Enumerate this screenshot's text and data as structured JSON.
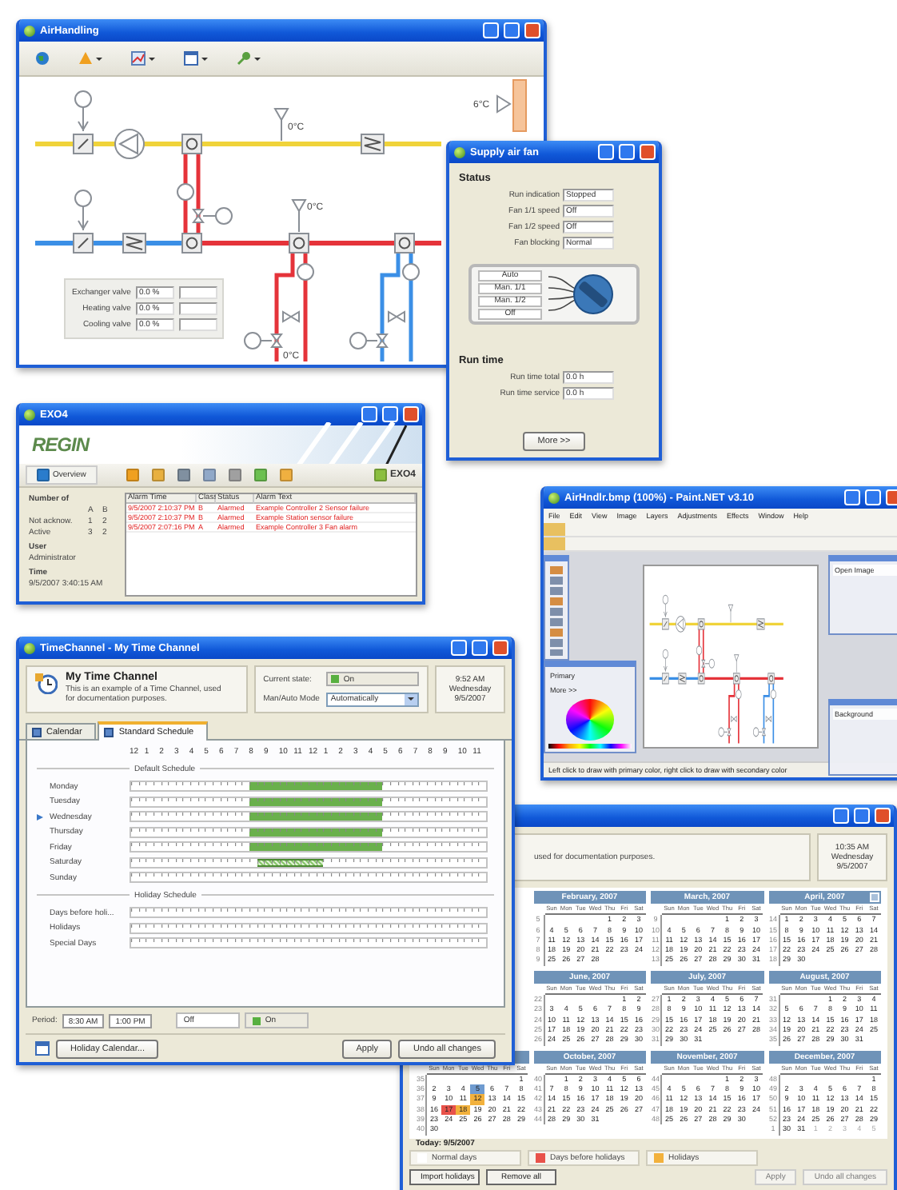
{
  "airhandling": {
    "title": "AirHandling",
    "temps": {
      "supply": "0°C",
      "heating": "0°C",
      "water": "0°C",
      "outdoor": "6°C"
    },
    "valves": [
      {
        "label": "Exchanger valve",
        "value": "0.0 %"
      },
      {
        "label": "Heating valve",
        "value": "0.0 %"
      },
      {
        "label": "Cooling valve",
        "value": "0.0 %"
      }
    ]
  },
  "fan": {
    "title": "Supply air fan",
    "status_heading": "Status",
    "status": [
      {
        "label": "Run indication",
        "value": "Stopped"
      },
      {
        "label": "Fan 1/1 speed",
        "value": "Off"
      },
      {
        "label": "Fan 1/2 speed",
        "value": "Off"
      },
      {
        "label": "Fan blocking",
        "value": "Normal"
      }
    ],
    "switch": [
      "Auto",
      "Man. 1/1",
      "Man. 1/2",
      "Off"
    ],
    "runtime_heading": "Run time",
    "runtime": [
      {
        "label": "Run time total",
        "value": "0.0 h"
      },
      {
        "label": "Run time service",
        "value": "0.0 h"
      }
    ],
    "button": "More >>"
  },
  "exo": {
    "title": "EXO4",
    "logo": "REGIN",
    "overview": "Overview",
    "brand": "EXO4",
    "summary": {
      "heading": "Number of",
      "columns": [
        "A",
        "B"
      ],
      "rows": [
        {
          "label": "Not acknow.",
          "values": [
            "1",
            "2"
          ]
        },
        {
          "label": "Active",
          "values": [
            "3",
            "2"
          ]
        }
      ]
    },
    "user_heading": "User",
    "user": "Administrator",
    "time_heading": "Time",
    "time": "9/5/2007 3:40:15 AM",
    "alarms": {
      "columns": [
        "Alarm Time",
        "Class",
        "Status",
        "Alarm Text"
      ],
      "rows": [
        [
          "9/5/2007 2:10:37 PM",
          "B",
          "Alarmed",
          "Example Controller 2 Sensor failure"
        ],
        [
          "9/5/2007 2:10:37 PM",
          "B",
          "Alarmed",
          "Example Station sensor failure"
        ],
        [
          "9/5/2007 2:07:16 PM",
          "A",
          "Alarmed",
          "Example Controller 3 Fan alarm"
        ]
      ]
    }
  },
  "paint": {
    "title": "AirHndlr.bmp (100%) - Paint.NET v3.10",
    "menu": [
      "File",
      "Edit",
      "View",
      "Image",
      "Layers",
      "Adjustments",
      "Effects",
      "Window",
      "Help"
    ],
    "history": [
      "Open Image"
    ],
    "layers": [
      "Background"
    ],
    "color_mode": "Primary",
    "more": "More >>",
    "status": "Left click to draw with primary color, right click to draw with secondary color"
  },
  "timechannel": {
    "title": "TimeChannel - My Time Channel",
    "name": "My Time Channel",
    "description": "This is an example of a Time Channel, used for documentation purposes.",
    "current_state_label": "Current state:",
    "current_state": "On",
    "mode_label": "Man/Auto Mode",
    "mode": "Automatically",
    "clock": [
      "9:52 AM",
      "Wednesday",
      "9/5/2007"
    ],
    "tabs": [
      {
        "label": "Calendar",
        "selected": false
      },
      {
        "label": "Standard Schedule",
        "selected": true
      }
    ],
    "hours": [
      "12",
      "1",
      "2",
      "3",
      "4",
      "5",
      "6",
      "7",
      "8",
      "9",
      "10",
      "11",
      "12",
      "1",
      "2",
      "3",
      "4",
      "5",
      "6",
      "7",
      "8",
      "9",
      "10",
      "11"
    ],
    "default_heading": "Default Schedule",
    "days": [
      {
        "label": "Monday",
        "current": false,
        "selected": false,
        "slots": [
          false,
          false,
          false,
          false,
          false,
          false,
          false,
          false,
          false,
          false,
          false,
          false,
          false,
          false,
          false,
          false,
          true,
          true,
          true,
          true,
          true,
          true,
          true,
          true,
          true,
          true,
          true,
          true,
          true,
          true,
          true,
          true,
          true,
          true,
          false,
          false,
          false,
          false,
          false,
          false,
          false,
          false,
          false,
          false,
          false,
          false,
          false,
          false
        ]
      },
      {
        "label": "Tuesday",
        "current": false,
        "selected": false,
        "slots": [
          false,
          false,
          false,
          false,
          false,
          false,
          false,
          false,
          false,
          false,
          false,
          false,
          false,
          false,
          false,
          false,
          true,
          true,
          true,
          true,
          true,
          true,
          true,
          true,
          true,
          true,
          true,
          true,
          true,
          true,
          true,
          true,
          true,
          true,
          false,
          false,
          false,
          false,
          false,
          false,
          false,
          false,
          false,
          false,
          false,
          false,
          false,
          false
        ]
      },
      {
        "label": "Wednesday",
        "current": true,
        "selected": false,
        "slots": [
          false,
          false,
          false,
          false,
          false,
          false,
          false,
          false,
          false,
          false,
          false,
          false,
          false,
          false,
          false,
          false,
          true,
          true,
          true,
          true,
          true,
          true,
          true,
          true,
          true,
          true,
          true,
          true,
          true,
          true,
          true,
          true,
          true,
          true,
          false,
          false,
          false,
          false,
          false,
          false,
          false,
          false,
          false,
          false,
          false,
          false,
          false,
          false
        ]
      },
      {
        "label": "Thursday",
        "current": false,
        "selected": false,
        "slots": [
          false,
          false,
          false,
          false,
          false,
          false,
          false,
          false,
          false,
          false,
          false,
          false,
          false,
          false,
          false,
          false,
          true,
          true,
          true,
          true,
          true,
          true,
          true,
          true,
          true,
          true,
          true,
          true,
          true,
          true,
          true,
          true,
          true,
          true,
          false,
          false,
          false,
          false,
          false,
          false,
          false,
          false,
          false,
          false,
          false,
          false,
          false,
          false
        ]
      },
      {
        "label": "Friday",
        "current": false,
        "selected": false,
        "slots": [
          false,
          false,
          false,
          false,
          false,
          false,
          false,
          false,
          false,
          false,
          false,
          false,
          false,
          false,
          false,
          false,
          true,
          true,
          true,
          true,
          true,
          true,
          true,
          true,
          true,
          true,
          true,
          true,
          true,
          true,
          true,
          true,
          true,
          true,
          false,
          false,
          false,
          false,
          false,
          false,
          false,
          false,
          false,
          false,
          false,
          false,
          false,
          false
        ]
      },
      {
        "label": "Saturday",
        "current": false,
        "selected": true,
        "slots": [
          false,
          false,
          false,
          false,
          false,
          false,
          false,
          false,
          false,
          false,
          false,
          false,
          false,
          false,
          false,
          false,
          false,
          true,
          true,
          true,
          true,
          true,
          true,
          true,
          true,
          true,
          false,
          false,
          false,
          false,
          false,
          false,
          false,
          false,
          false,
          false,
          false,
          false,
          false,
          false,
          false,
          false,
          false,
          false,
          false,
          false,
          false,
          false
        ]
      },
      {
        "label": "Sunday",
        "current": false,
        "slots": [
          false,
          false,
          false,
          false,
          false,
          false,
          false,
          false,
          false,
          false,
          false,
          false,
          false,
          false,
          false,
          false,
          false,
          false,
          false,
          false,
          false,
          false,
          false,
          false,
          false,
          false,
          false,
          false,
          false,
          false,
          false,
          false,
          false,
          false,
          false,
          false,
          false,
          false,
          false,
          false,
          false,
          false,
          false,
          false,
          false,
          false,
          false,
          false
        ]
      }
    ],
    "holiday_heading": "Holiday Schedule",
    "holiday_days": [
      {
        "label": "Days before holi...",
        "current": false,
        "slots": [
          false,
          false,
          false,
          false,
          false,
          false,
          false,
          false,
          false,
          false,
          false,
          false,
          false,
          false,
          false,
          false,
          false,
          false,
          false,
          false,
          false,
          false,
          false,
          false,
          false,
          false,
          false,
          false,
          false,
          false,
          false,
          false,
          false,
          false,
          false,
          false,
          false,
          false,
          false,
          false,
          false,
          false,
          false,
          false,
          false,
          false,
          false,
          false
        ]
      },
      {
        "label": "Holidays",
        "current": false,
        "slots": [
          false,
          false,
          false,
          false,
          false,
          false,
          false,
          false,
          false,
          false,
          false,
          false,
          false,
          false,
          false,
          false,
          false,
          false,
          false,
          false,
          false,
          false,
          false,
          false,
          false,
          false,
          false,
          false,
          false,
          false,
          false,
          false,
          false,
          false,
          false,
          false,
          false,
          false,
          false,
          false,
          false,
          false,
          false,
          false,
          false,
          false,
          false,
          false
        ]
      },
      {
        "label": "Special Days",
        "current": false,
        "slots": [
          false,
          false,
          false,
          false,
          false,
          false,
          false,
          false,
          false,
          false,
          false,
          false,
          false,
          false,
          false,
          false,
          false,
          false,
          false,
          false,
          false,
          false,
          false,
          false,
          false,
          false,
          false,
          false,
          false,
          false,
          false,
          false,
          false,
          false,
          false,
          false,
          false,
          false,
          false,
          false,
          false,
          false,
          false,
          false,
          false,
          false,
          false,
          false
        ]
      }
    ],
    "period_label": "Period:",
    "period_from": "8:30 AM",
    "period_to": "1:00 PM",
    "states": [
      {
        "label": "Off",
        "selected": false
      },
      {
        "label": "On",
        "selected": true
      }
    ],
    "buttons": {
      "holiday": "Holiday Calendar...",
      "apply": "Apply",
      "undo": "Undo all changes"
    }
  },
  "calendar": {
    "description": "used for documentation purposes.",
    "clock": [
      "10:35 AM",
      "Wednesday",
      "9/5/2007"
    ],
    "months": [
      {
        "name": "February, 2007",
        "weekdays": [
          "Sun",
          "Mon",
          "Tue",
          "Wed",
          "Thu",
          "Fri",
          "Sat"
        ],
        "weeks": [
          {
            "no": "5",
            "days": [
              "1",
              "2",
              "3"
            ]
          },
          {
            "no": "6",
            "days": [
              "4",
              "5",
              "6",
              "7",
              "8",
              "9",
              "10"
            ]
          },
          {
            "no": "7",
            "days": [
              "11",
              "12",
              "13",
              "14",
              "15",
              "16",
              "17"
            ]
          },
          {
            "no": "8",
            "days": [
              "18",
              "19",
              "20",
              "21",
              "22",
              "23",
              "24"
            ]
          },
          {
            "no": "9",
            "days": [
              "25",
              "26",
              "27",
              "28"
            ]
          }
        ]
      },
      {
        "name": "March, 2007",
        "weekdays": [
          "Sun",
          "Mon",
          "Tue",
          "Wed",
          "Thu",
          "Fri",
          "Sat"
        ],
        "weeks": [
          {
            "no": "9",
            "days": [
              "1",
              "2",
              "3"
            ]
          },
          {
            "no": "10",
            "days": [
              "4",
              "5",
              "6",
              "7",
              "8",
              "9",
              "10"
            ]
          },
          {
            "no": "11",
            "days": [
              "11",
              "12",
              "13",
              "14",
              "15",
              "16",
              "17"
            ]
          },
          {
            "no": "12",
            "days": [
              "18",
              "19",
              "20",
              "21",
              "22",
              "23",
              "24"
            ]
          },
          {
            "no": "13",
            "days": [
              "25",
              "26",
              "27",
              "28",
              "29",
              "30",
              "31"
            ]
          }
        ]
      },
      {
        "name": "April, 2007",
        "next_button": true,
        "weekdays": [
          "Sun",
          "Mon",
          "Tue",
          "Wed",
          "Thu",
          "Fri",
          "Sat"
        ],
        "weeks": [
          {
            "no": "14",
            "days": [
              "1",
              "2",
              "3",
              "4",
              "5",
              "6",
              "7"
            ]
          },
          {
            "no": "15",
            "days": [
              "8",
              "9",
              "10",
              "11",
              "12",
              "13",
              "14"
            ]
          },
          {
            "no": "16",
            "days": [
              "15",
              "16",
              "17",
              "18",
              "19",
              "20",
              "21"
            ]
          },
          {
            "no": "17",
            "days": [
              "22",
              "23",
              "24",
              "25",
              "26",
              "27",
              "28"
            ]
          },
          {
            "no": "18",
            "days": [
              "29",
              "30"
            ]
          }
        ]
      },
      {
        "name": "June, 2007",
        "weekdays": [
          "Sun",
          "Mon",
          "Tue",
          "Wed",
          "Thu",
          "Fri",
          "Sat"
        ],
        "weeks": [
          {
            "no": "22",
            "days": [
              "1",
              "2"
            ]
          },
          {
            "no": "23",
            "days": [
              "3",
              "4",
              "5",
              "6",
              "7",
              "8",
              "9"
            ]
          },
          {
            "no": "24",
            "days": [
              "10",
              "11",
              "12",
              "13",
              "14",
              "15",
              "16"
            ]
          },
          {
            "no": "25",
            "days": [
              "17",
              "18",
              "19",
              "20",
              "21",
              "22",
              "23"
            ]
          },
          {
            "no": "26",
            "days": [
              "24",
              "25",
              "26",
              "27",
              "28",
              "29",
              "30"
            ]
          }
        ]
      },
      {
        "name": "July, 2007",
        "weekdays": [
          "Sun",
          "Mon",
          "Tue",
          "Wed",
          "Thu",
          "Fri",
          "Sat"
        ],
        "weeks": [
          {
            "no": "27",
            "days": [
              "1",
              "2",
              "3",
              "4",
              "5",
              "6",
              "7"
            ]
          },
          {
            "no": "28",
            "days": [
              "8",
              "9",
              "10",
              "11",
              "12",
              "13",
              "14"
            ]
          },
          {
            "no": "29",
            "days": [
              "15",
              "16",
              "17",
              "18",
              "19",
              "20",
              "21"
            ]
          },
          {
            "no": "30",
            "days": [
              "22",
              "23",
              "24",
              "25",
              "26",
              "27",
              "28"
            ]
          },
          {
            "no": "31",
            "days": [
              "29",
              "30",
              "31"
            ]
          }
        ]
      },
      {
        "name": "August, 2007",
        "weekdays": [
          "Sun",
          "Mon",
          "Tue",
          "Wed",
          "Thu",
          "Fri",
          "Sat"
        ],
        "weeks": [
          {
            "no": "31",
            "days": [
              "1",
              "2",
              "3",
              "4"
            ]
          },
          {
            "no": "32",
            "days": [
              "5",
              "6",
              "7",
              "8",
              "9",
              "10",
              "11"
            ]
          },
          {
            "no": "33",
            "days": [
              "12",
              "13",
              "14",
              "15",
              "16",
              "17",
              "18"
            ]
          },
          {
            "no": "34",
            "days": [
              "19",
              "20",
              "21",
              "22",
              "23",
              "24",
              "25"
            ]
          },
          {
            "no": "35",
            "days": [
              "26",
              "27",
              "28",
              "29",
              "30",
              "31"
            ]
          }
        ]
      },
      {
        "weekdays": [
          "Sun",
          "Mon",
          "Tue",
          "Wed",
          "Thu",
          "Fri",
          "Sat"
        ],
        "weeks": [
          {
            "no": "35",
            "days": [
              "1"
            ]
          },
          {
            "no": "36",
            "days": [
              "2",
              "3",
              "4",
              {
                "text": "5",
                "kind": "today"
              },
              "6",
              "7",
              "8"
            ]
          },
          {
            "no": "37",
            "days": [
              "9",
              "10",
              "11",
              {
                "text": "12",
                "kind": "holiday"
              },
              "13",
              "14",
              "15"
            ]
          },
          {
            "no": "38",
            "days": [
              "16",
              {
                "text": "17",
                "kind": "before_holiday"
              },
              {
                "text": "18",
                "kind": "holiday"
              },
              "19",
              "20",
              "21",
              "22"
            ]
          },
          {
            "no": "39",
            "days": [
              "23",
              "24",
              "25",
              "26",
              "27",
              "28",
              "29"
            ]
          },
          {
            "no": "40",
            "days": [
              "30"
            ]
          }
        ]
      },
      {
        "name": "October, 2007",
        "weekdays": [
          "Sun",
          "Mon",
          "Tue",
          "Wed",
          "Thu",
          "Fri",
          "Sat"
        ],
        "weeks": [
          {
            "no": "40",
            "days": [
              "1",
              "2",
              "3",
              "4",
              "5",
              "6"
            ]
          },
          {
            "no": "41",
            "days": [
              "7",
              "8",
              "9",
              "10",
              "11",
              "12",
              "13"
            ]
          },
          {
            "no": "42",
            "days": [
              "14",
              "15",
              "16",
              "17",
              "18",
              "19",
              "20"
            ]
          },
          {
            "no": "43",
            "days": [
              "21",
              "22",
              "23",
              "24",
              "25",
              "26",
              "27"
            ]
          },
          {
            "no": "44",
            "days": [
              "28",
              "29",
              "30",
              "31"
            ]
          }
        ]
      },
      {
        "name": "November, 2007",
        "weekdays": [
          "Sun",
          "Mon",
          "Tue",
          "Wed",
          "Thu",
          "Fri",
          "Sat"
        ],
        "weeks": [
          {
            "no": "44",
            "days": [
              "1",
              "2",
              "3"
            ]
          },
          {
            "no": "45",
            "days": [
              "4",
              "5",
              "6",
              "7",
              "8",
              "9",
              "10"
            ]
          },
          {
            "no": "46",
            "days": [
              "11",
              "12",
              "13",
              "14",
              "15",
              "16",
              "17"
            ]
          },
          {
            "no": "47",
            "days": [
              "18",
              "19",
              "20",
              "21",
              "22",
              "23",
              "24"
            ]
          },
          {
            "no": "48",
            "days": [
              "25",
              "26",
              "27",
              "28",
              "29",
              "30"
            ]
          }
        ]
      },
      {
        "name": "December, 2007",
        "weekdays": [
          "Sun",
          "Mon",
          "Tue",
          "Wed",
          "Thu",
          "Fri",
          "Sat"
        ],
        "weeks": [
          {
            "no": "48",
            "days": [
              "1"
            ]
          },
          {
            "no": "49",
            "days": [
              "2",
              "3",
              "4",
              "5",
              "6",
              "7",
              "8"
            ]
          },
          {
            "no": "50",
            "days": [
              "9",
              "10",
              "11",
              "12",
              "13",
              "14",
              "15"
            ]
          },
          {
            "no": "51",
            "days": [
              "16",
              "17",
              "18",
              "19",
              "20",
              "21",
              "22"
            ]
          },
          {
            "no": "52",
            "days": [
              "23",
              "24",
              "25",
              "26",
              "27",
              "28",
              "29"
            ]
          },
          {
            "no": "1",
            "days": [
              "30",
              "31",
              {
                "text": "1",
                "kind": "other"
              },
              {
                "text": "2",
                "kind": "other"
              },
              {
                "text": "3",
                "kind": "other"
              },
              {
                "text": "4",
                "kind": "other"
              },
              {
                "text": "5",
                "kind": "other"
              }
            ]
          }
        ]
      }
    ],
    "today": "Today: 9/5/2007",
    "legend": [
      {
        "label": "Normal days",
        "color": "#ffffff"
      },
      {
        "label": "Days before holidays",
        "color": "#e8524a"
      },
      {
        "label": "Holidays",
        "color": "#f2b13c"
      }
    ],
    "buttons": [
      {
        "label": "Import holidays",
        "disabled": false
      },
      {
        "label": "Remove all",
        "disabled": false
      },
      {
        "label": "Apply",
        "disabled": true
      },
      {
        "label": "Undo all changes",
        "disabled": true
      }
    ]
  }
}
